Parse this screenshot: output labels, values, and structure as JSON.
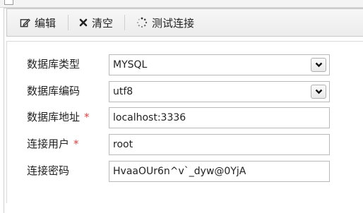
{
  "toolbar": {
    "edit_label": "编辑",
    "clear_label": "清空",
    "test_label": "测试连接"
  },
  "form": {
    "db_type": {
      "label": "数据库类型",
      "value": "MYSQL",
      "required": false
    },
    "db_encoding": {
      "label": "数据库编码",
      "value": "utf8",
      "required": false
    },
    "db_address": {
      "label": "数据库地址",
      "value": "localhost:3336",
      "required": true
    },
    "db_user": {
      "label": "连接用户",
      "value": "root",
      "required": true
    },
    "db_password": {
      "label": "连接密码",
      "value": "HvaaOUr6n^v`_dyw@0YjA",
      "required": false
    },
    "required_mark": "*"
  },
  "icons": {
    "edit": "edit-icon",
    "clear": "x-icon",
    "test": "spinner-icon",
    "dropdown": "chevron-down-icon"
  },
  "colors": {
    "required": "#e04040",
    "toolbar_bg": "#efefef",
    "border": "#b9b9b9"
  }
}
